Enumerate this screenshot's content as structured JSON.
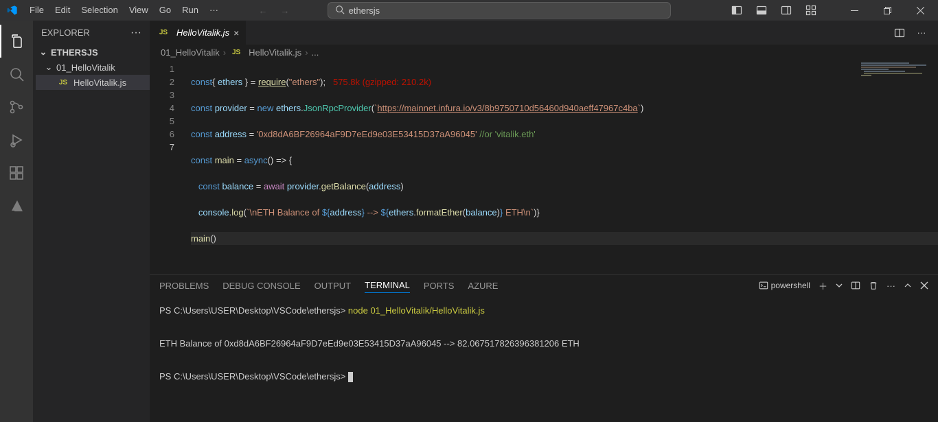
{
  "menu": {
    "items": [
      "File",
      "Edit",
      "Selection",
      "View",
      "Go",
      "Run"
    ],
    "more": "···"
  },
  "search": {
    "placeholder": "ethersjs"
  },
  "sidebar": {
    "title": "EXPLORER",
    "project": "ETHERSJS",
    "folder1": "01_HelloVitalik",
    "file1": "HelloVitalik.js"
  },
  "tab": {
    "filename": "HelloVitalik.js",
    "iconlabel": "JS"
  },
  "breadcrumb": {
    "folder": "01_HelloVitalik",
    "file": "HelloVitalik.js",
    "more": "..."
  },
  "code": {
    "lines": [
      "1",
      "2",
      "3",
      "4",
      "5",
      "6",
      "7"
    ],
    "l1_const": "const",
    "l1_brace_o": "{ ",
    "l1_ethers": "ethers",
    "l1_brace_c": " }",
    "l1_eq": " = ",
    "l1_req": "require",
    "l1_paren_o": "(",
    "l1_str": "\"ethers\"",
    "l1_paren_c": ");",
    "l1_size": "   575.8k (gzipped: 210.2k)",
    "l2_const": "const",
    "l2_provider": " provider",
    "l2_eq": " = ",
    "l2_new": "new",
    "l2_sp": " ",
    "l2_ethers": "ethers",
    "l2_dot": ".",
    "l2_ctor": "JsonRpcProvider",
    "l2_p1": "(",
    "l2_bt": "`",
    "l2_url": "https://mainnet.infura.io/v3/8b9750710d56460d940aeff47967c4ba",
    "l2_bt2": "`",
    "l2_p2": ")",
    "l3_const": "const",
    "l3_addr": " address",
    "l3_eq": " = ",
    "l3_str": "'0xd8dA6BF26964aF9D7eEd9e03E53415D37aA96045'",
    "l3_cmt": " //or 'vitalik.eth'",
    "l4_const": "const",
    "l4_main": " main",
    "l4_eq": " = ",
    "l4_async": "async",
    "l4_arrow": "() => {",
    "l5_const": "const",
    "l5_bal": " balance",
    "l5_eq": " = ",
    "l5_await": "await",
    "l5_sp": " ",
    "l5_prov": "provider",
    "l5_dot": ".",
    "l5_fn": "getBalance",
    "l5_p1": "(",
    "l5_arg": "address",
    "l5_p2": ")",
    "l6_cons": "console",
    "l6_dot": ".",
    "l6_log": "log",
    "l6_p1": "(",
    "l6_bt": "`",
    "l6_s1": "\\nETH Balance of ",
    "l6_d1": "${",
    "l6_a1": "address",
    "l6_d2": "}",
    "l6_s2": " --> ",
    "l6_d3": "${",
    "l6_e": "ethers",
    "l6_dot2": ".",
    "l6_fe": "formatEther",
    "l6_p2": "(",
    "l6_b": "balance",
    "l6_p3": ")",
    "l6_d4": "}",
    "l6_s3": " ETH\\n",
    "l6_bt2": "`",
    "l6_p4": ")",
    "l6_brace": "}",
    "l7": "main",
    "l7_p": "()"
  },
  "panel": {
    "tabs": {
      "problems": "PROBLEMS",
      "debug": "DEBUG CONSOLE",
      "output": "OUTPUT",
      "terminal": "TERMINAL",
      "ports": "PORTS",
      "azure": "AZURE"
    },
    "shell": "powershell"
  },
  "terminal": {
    "l1_prompt": "PS C:\\Users\\USER\\Desktop\\VSCode\\ethersjs> ",
    "l1_cmd": "node 01_HelloVitalik/HelloVitalik.js",
    "l2": "ETH Balance of 0xd8dA6BF26964aF9D7eEd9e03E53415D37aA96045 --> 82.067517826396381206 ETH",
    "l3_prompt": "PS C:\\Users\\USER\\Desktop\\VSCode\\ethersjs> "
  }
}
